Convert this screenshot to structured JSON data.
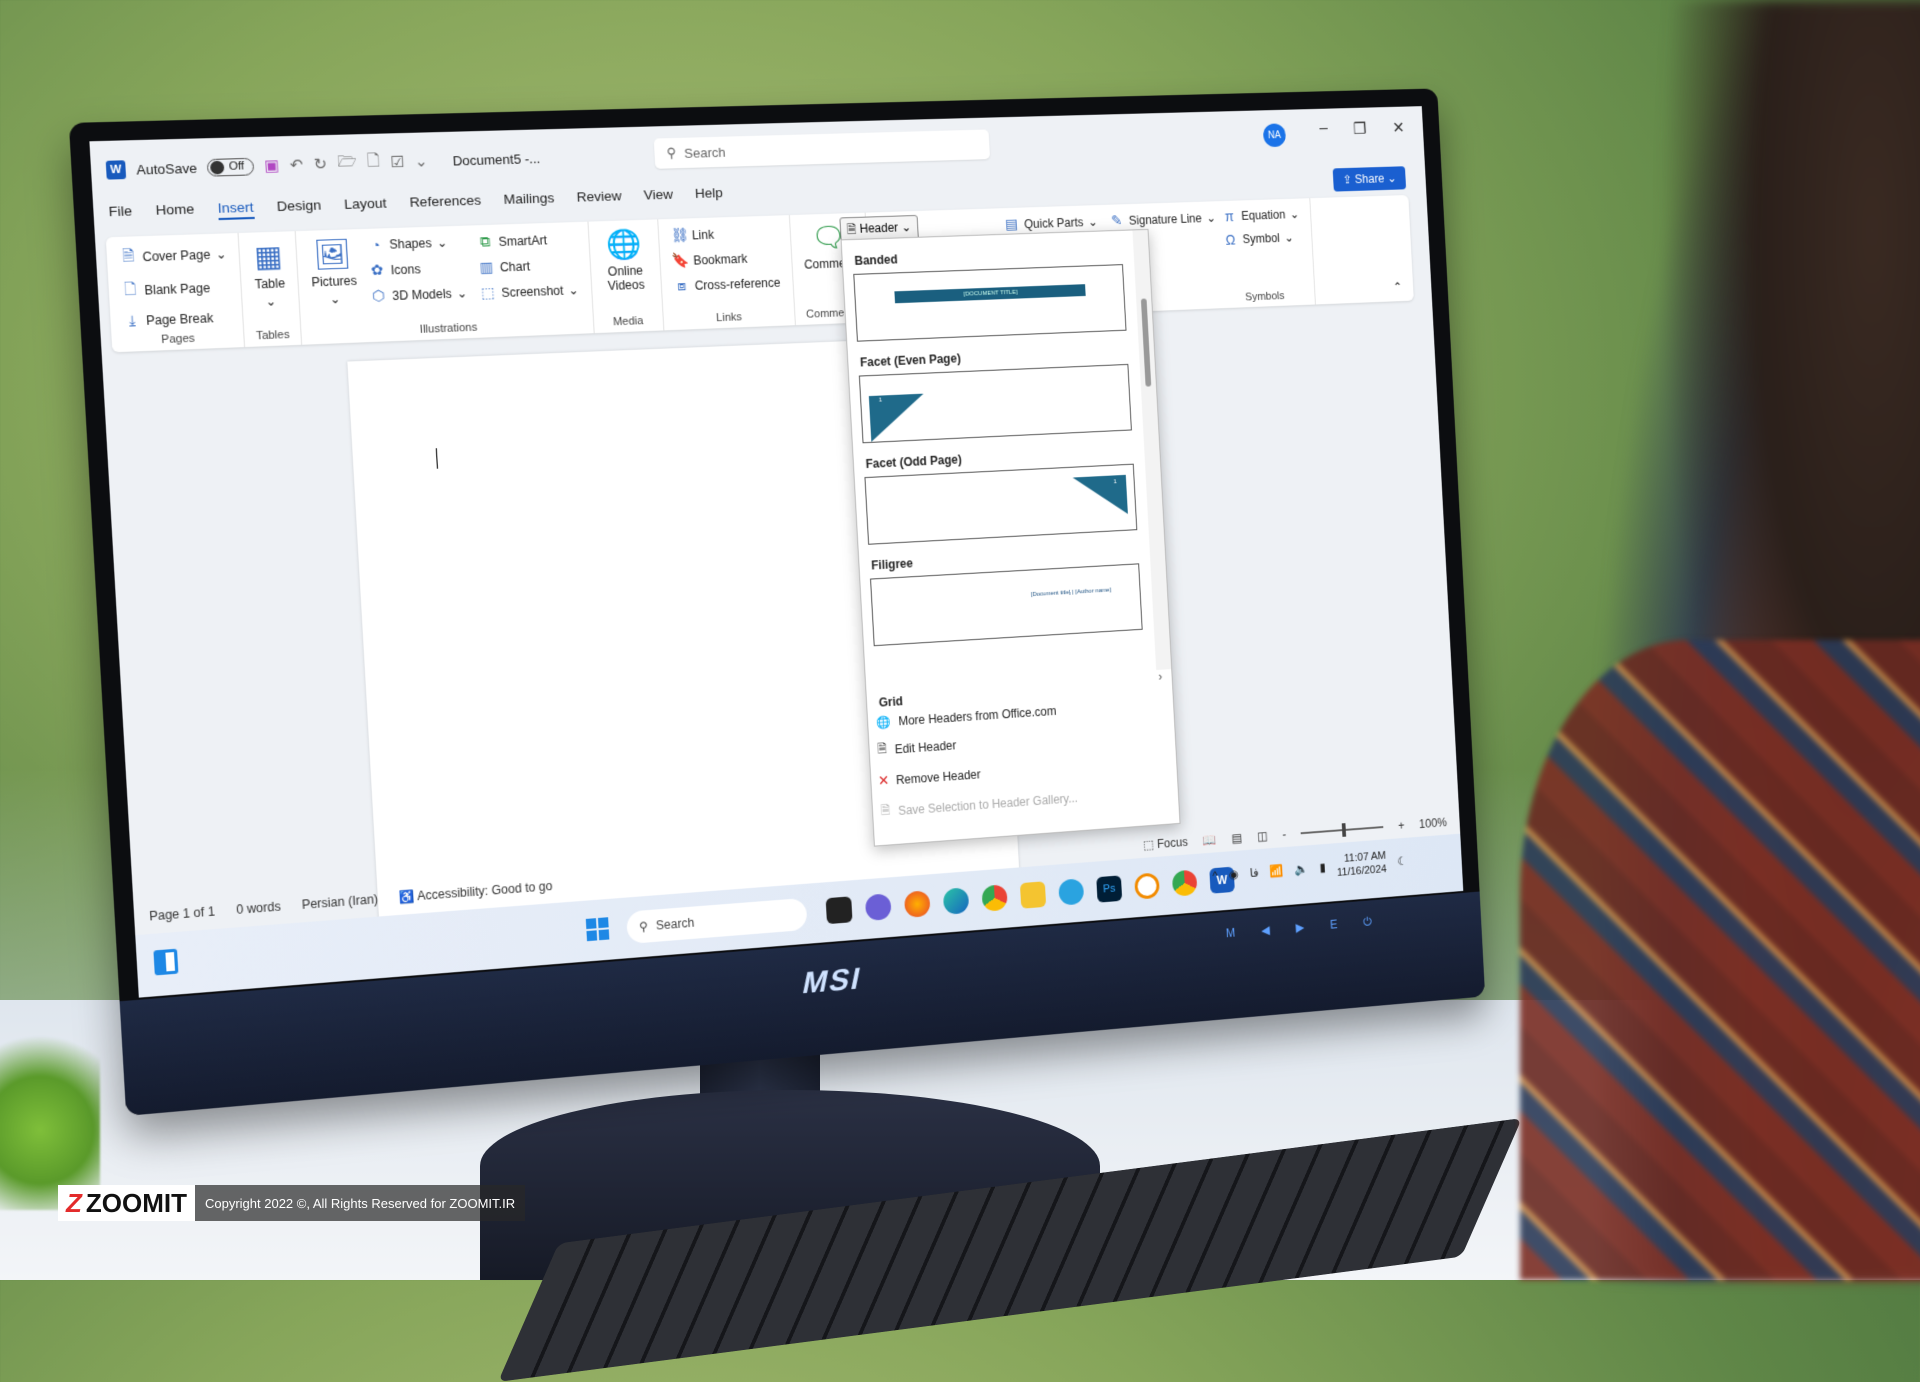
{
  "titlebar": {
    "app_icon": "word-icon",
    "autosave_label": "AutoSave",
    "autosave_state": "Off",
    "document_title": "Document5 -...",
    "search_placeholder": "Search",
    "avatar_initials": "NA",
    "share_label": "Share"
  },
  "tabs": [
    "File",
    "Home",
    "Insert",
    "Design",
    "Layout",
    "References",
    "Mailings",
    "Review",
    "View",
    "Help"
  ],
  "active_tab": "Insert",
  "ribbon": {
    "pages": {
      "label": "Pages",
      "items": [
        "Cover Page",
        "Blank Page",
        "Page Break"
      ]
    },
    "tables": {
      "label": "Tables",
      "items": [
        "Table"
      ]
    },
    "illustrations": {
      "label": "Illustrations",
      "items": [
        "Pictures",
        "Shapes",
        "Icons",
        "3D Models",
        "SmartArt",
        "Chart",
        "Screenshot"
      ]
    },
    "media": {
      "label": "Media",
      "items": [
        "Online Videos"
      ]
    },
    "links": {
      "label": "Links",
      "items": [
        "Link",
        "Bookmark",
        "Cross-reference"
      ]
    },
    "comments": {
      "label": "Comments",
      "items": [
        "Comment"
      ]
    },
    "header_footer": {
      "header_button": "Header"
    },
    "text": {
      "items": [
        "Quick Parts",
        "Signature Line"
      ]
    },
    "symbols": {
      "label": "Symbols",
      "items": [
        "Equation",
        "Symbol"
      ]
    }
  },
  "header_gallery": {
    "items": [
      {
        "name": "Banded",
        "placeholder": "[DOCUMENT TITLE]"
      },
      {
        "name": "Facet (Even Page)",
        "placeholder": "1"
      },
      {
        "name": "Facet (Odd Page)",
        "placeholder": "1"
      },
      {
        "name": "Filigree",
        "placeholder": "[Document title] | [Author name]"
      }
    ],
    "next_section": "Grid",
    "menu": [
      {
        "label": "More Headers from Office.com",
        "enabled": true
      },
      {
        "label": "Edit Header",
        "enabled": true
      },
      {
        "label": "Remove Header",
        "enabled": true
      },
      {
        "label": "Save Selection to Header Gallery...",
        "enabled": false
      }
    ],
    "accent_color": "#1a5f7f"
  },
  "statusbar": {
    "page": "Page 1 of 1",
    "words": "0 words",
    "language": "Persian (Iran)",
    "accessibility": "Accessibility: Good to go",
    "focus": "Focus",
    "zoom": "100%",
    "zoom_minus": "-",
    "zoom_plus": "+"
  },
  "taskbar": {
    "search_placeholder": "Search",
    "time": "11:07 AM",
    "date": "11/16/2024",
    "input_language": "فا",
    "apps": [
      "Firefox",
      "Edge",
      "Chrome",
      "File Explorer",
      "Telegram",
      "Photoshop",
      "Chrome",
      "Word"
    ]
  },
  "monitor": {
    "brand": "MSI",
    "buttons": [
      "M",
      "◀",
      "▶",
      "E",
      "⏻"
    ]
  },
  "watermark": {
    "logo": "ZOOMIT",
    "copyright": "Copyright 2022 ©, All Rights Reserved for ZOOMIT.IR"
  }
}
